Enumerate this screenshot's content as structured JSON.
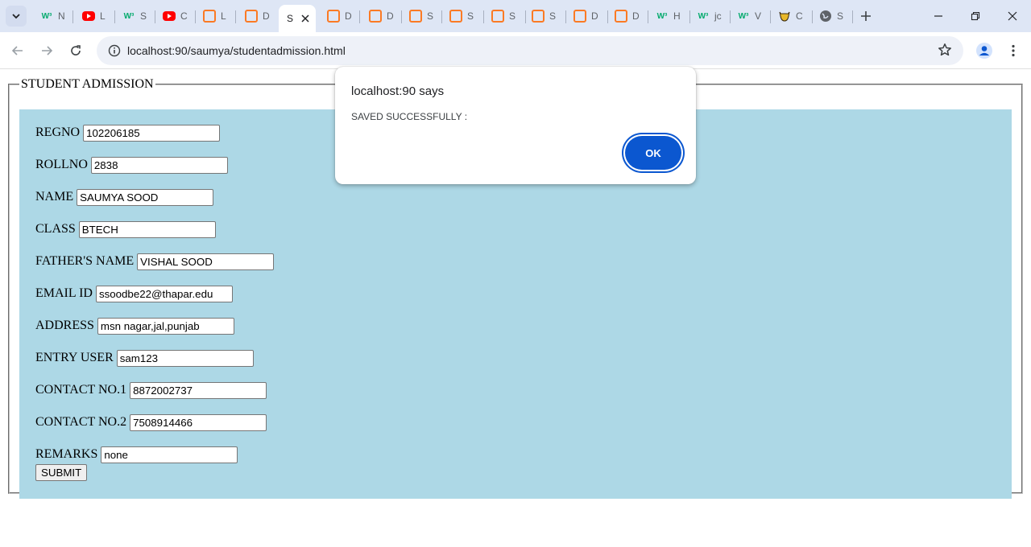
{
  "browser": {
    "tabs": [
      {
        "icon": "w3schools-icon",
        "title": "N"
      },
      {
        "icon": "youtube-icon",
        "title": "L"
      },
      {
        "icon": "w3schools-icon",
        "title": "S"
      },
      {
        "icon": "youtube-icon",
        "title": "C"
      },
      {
        "icon": "xampp-icon",
        "title": "L"
      },
      {
        "icon": "xampp-icon",
        "title": "D"
      },
      {
        "icon": "page-icon",
        "title": "S",
        "active": true
      },
      {
        "icon": "xampp-icon",
        "title": "D"
      },
      {
        "icon": "xampp-icon",
        "title": "D"
      },
      {
        "icon": "xampp-icon",
        "title": "S"
      },
      {
        "icon": "xampp-icon",
        "title": "S"
      },
      {
        "icon": "xampp-icon",
        "title": "S"
      },
      {
        "icon": "xampp-icon",
        "title": "S"
      },
      {
        "icon": "xampp-icon",
        "title": "D"
      },
      {
        "icon": "xampp-icon",
        "title": "D"
      },
      {
        "icon": "w3schools-icon",
        "title": "H"
      },
      {
        "icon": "w3schools-icon",
        "title": "jc"
      },
      {
        "icon": "w3schools-icon",
        "title": "V"
      },
      {
        "icon": "bull-icon",
        "title": "C"
      },
      {
        "icon": "globe-icon",
        "title": "S"
      }
    ],
    "url": "localhost:90/saumya/studentadmission.html"
  },
  "form": {
    "legend": "STUDENT ADMISSION",
    "fields": {
      "regno": {
        "label": "REGNO",
        "value": "102206185"
      },
      "rollno": {
        "label": "ROLLNO",
        "value": "2838"
      },
      "name": {
        "label": "NAME",
        "value": "SAUMYA SOOD"
      },
      "class": {
        "label": "CLASS",
        "value": "BTECH"
      },
      "father": {
        "label": "FATHER'S NAME",
        "value": "VISHAL SOOD"
      },
      "email": {
        "label": "EMAIL ID",
        "value": "ssoodbe22@thapar.edu"
      },
      "address": {
        "label": "ADDRESS",
        "value": "msn nagar,jal,punjab"
      },
      "entryuser": {
        "label": "ENTRY USER",
        "value": "sam123"
      },
      "contact1": {
        "label": "CONTACT NO.1",
        "value": "8872002737"
      },
      "contact2": {
        "label": "CONTACT NO.2",
        "value": "7508914466"
      },
      "remarks": {
        "label": "REMARKS",
        "value": "none"
      }
    },
    "submit_label": "SUBMIT",
    "background_color": "#add8e6"
  },
  "dialog": {
    "title": "localhost:90 says",
    "message": "SAVED SUCCESSFULLY :",
    "ok_label": "OK",
    "button_color": "#0b57d0"
  }
}
